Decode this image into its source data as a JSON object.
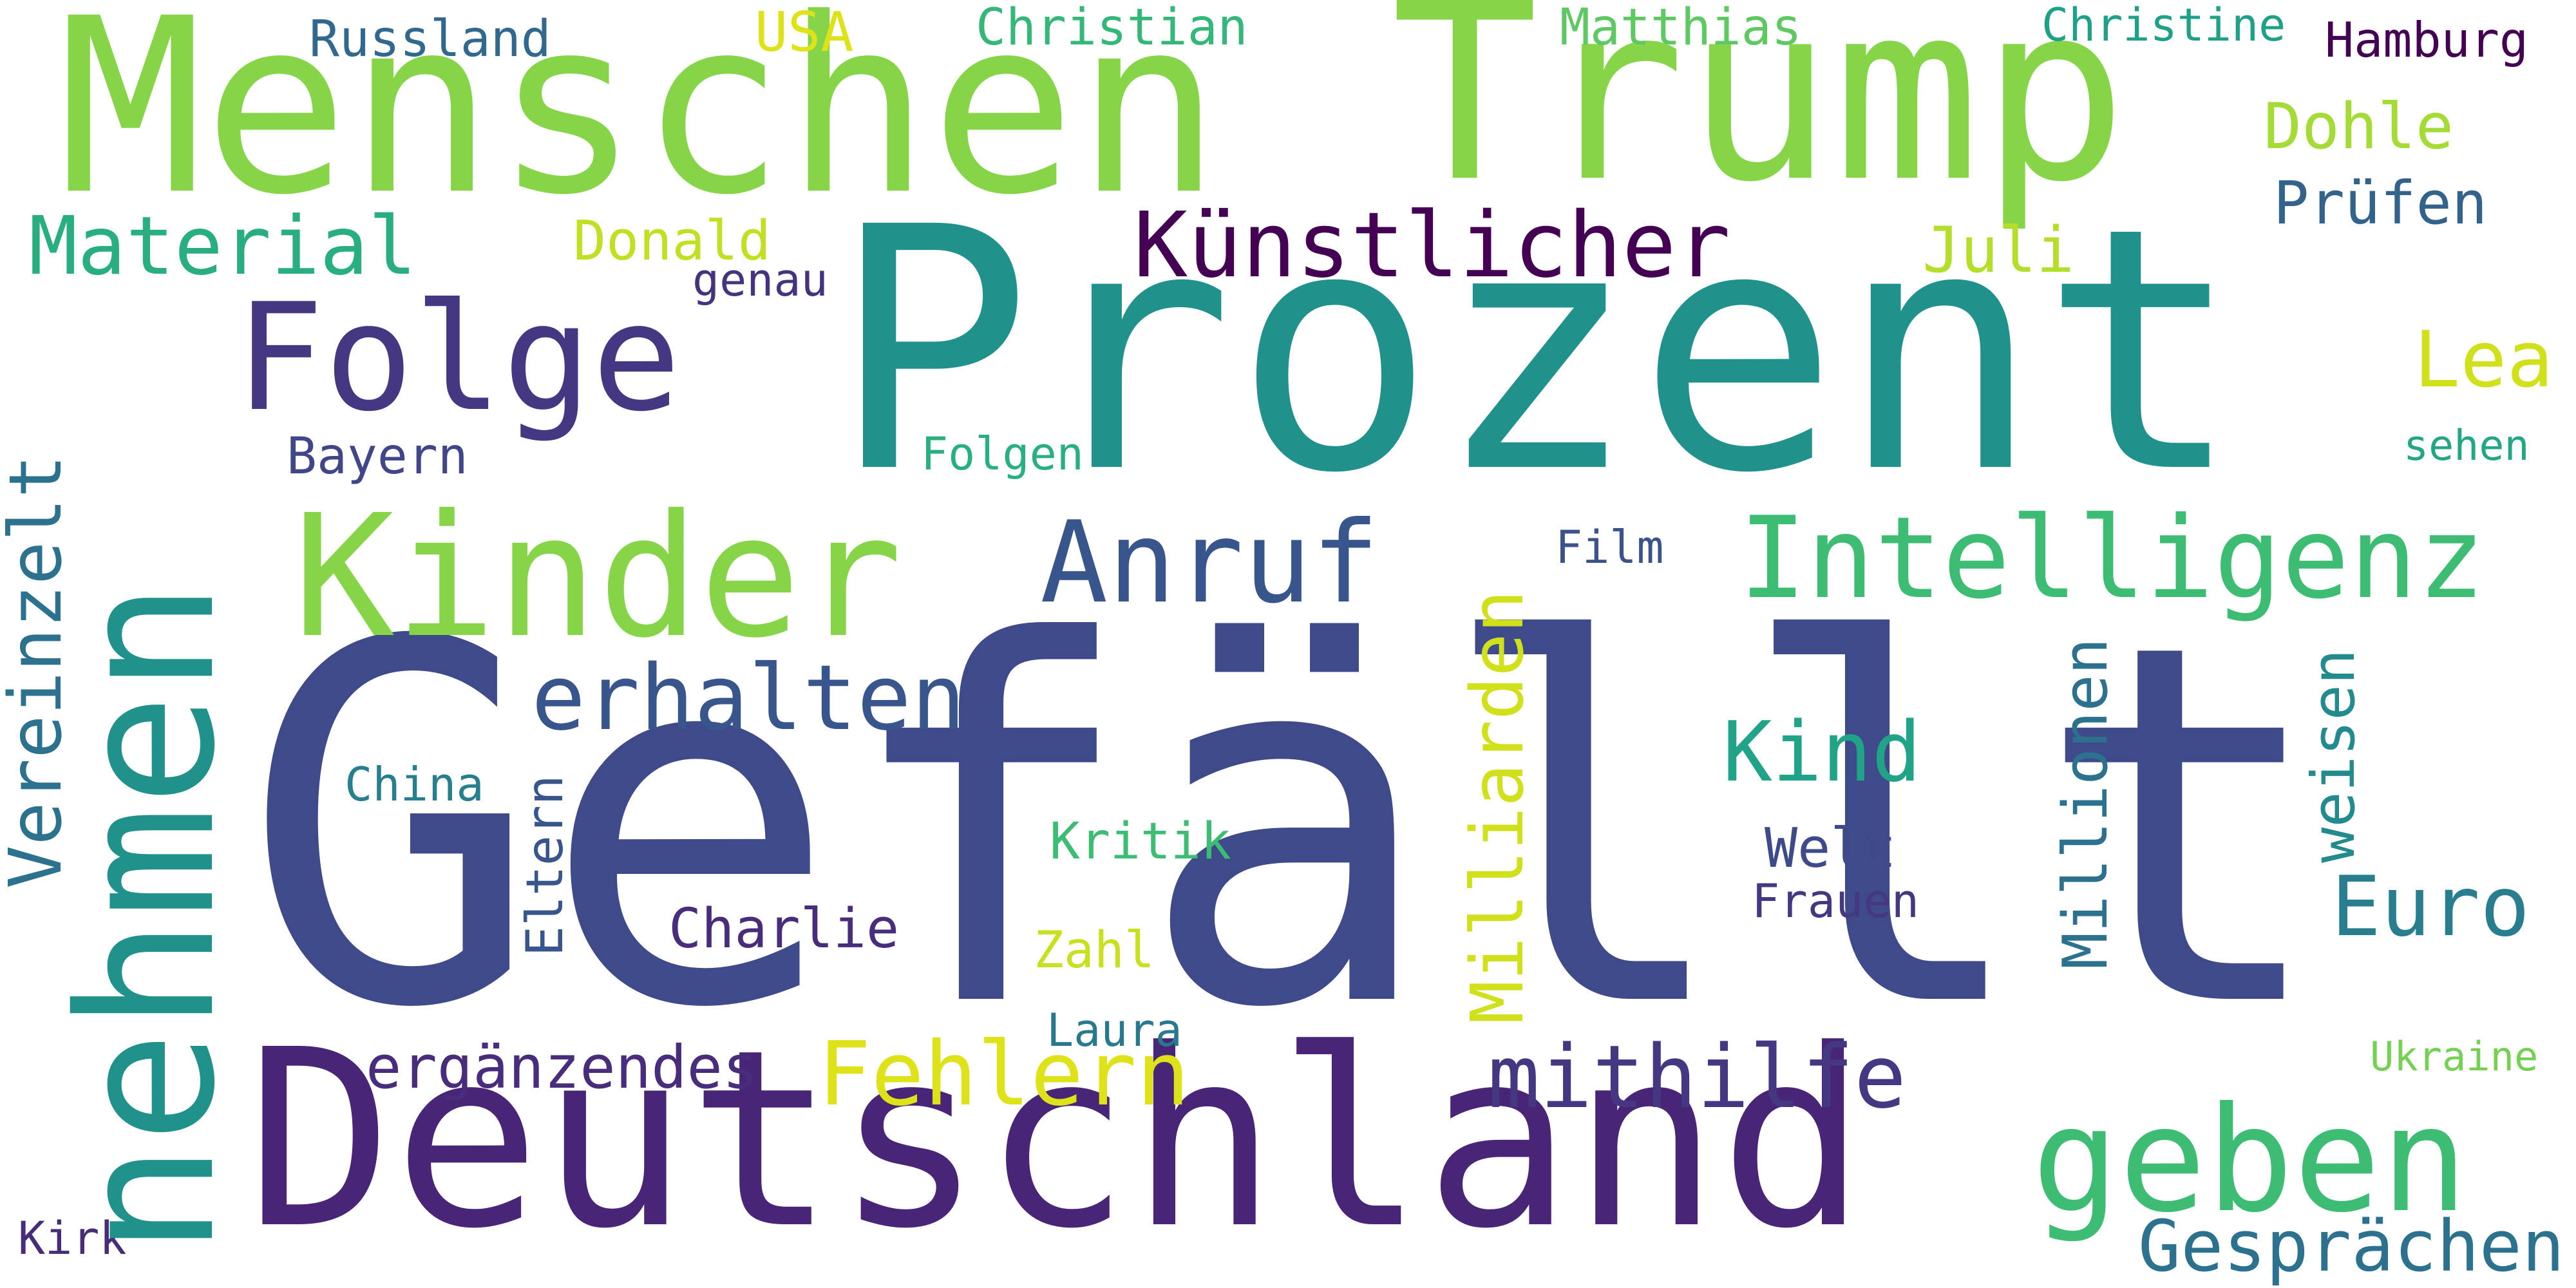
{
  "words": {
    "gefaellt": {
      "text": "Gefällt",
      "color": "#3e4a89"
    },
    "prozent": {
      "text": "Prozent",
      "color": "#21918c"
    },
    "deutschland": {
      "text": "Deutschland",
      "color": "#482576"
    },
    "menschen": {
      "text": "Menschen",
      "color": "#86d549"
    },
    "trump": {
      "text": "Trump",
      "color": "#86d549"
    },
    "nehmen": {
      "text": "nehmen",
      "color": "#21918c"
    },
    "kinder": {
      "text": "Kinder",
      "color": "#86d549"
    },
    "folge": {
      "text": "Folge",
      "color": "#453781"
    },
    "geben": {
      "text": "geben",
      "color": "#3dbc74"
    },
    "intelligenz": {
      "text": "Intelligenz",
      "color": "#3dbc74"
    },
    "kuenstlicher": {
      "text": "Künstlicher",
      "color": "#440154"
    },
    "anruf": {
      "text": "Anruf",
      "color": "#39568c"
    },
    "vereinzelt": {
      "text": "Vereinzelt",
      "color": "#2c728e"
    },
    "milliarden": {
      "text": "Milliarden",
      "color": "#d0e11c"
    },
    "erhalten": {
      "text": "erhalten",
      "color": "#39568c"
    },
    "mithilfe": {
      "text": "mithilfe",
      "color": "#453781"
    },
    "fehlern": {
      "text": "Fehlern",
      "color": "#dde318"
    },
    "material": {
      "text": "Material",
      "color": "#29af7f"
    },
    "kind": {
      "text": "Kind",
      "color": "#20a386"
    },
    "euro": {
      "text": "Euro",
      "color": "#287d8e"
    },
    "gespraechen": {
      "text": "Gesprächen",
      "color": "#2c728e"
    },
    "ergaenzendes": {
      "text": "ergänzendes",
      "color": "#472d7b"
    },
    "millionen": {
      "text": "Millionen",
      "color": "#2c728e"
    },
    "weisen": {
      "text": "weisen",
      "color": "#238a8d"
    },
    "dohle": {
      "text": "Dohle",
      "color": "#a5db36"
    },
    "lea": {
      "text": "Lea",
      "color": "#d0e11c"
    },
    "pruefen": {
      "text": "Prüfen",
      "color": "#33638d"
    },
    "juli": {
      "text": "Juli",
      "color": "#b5de2b"
    },
    "eltern": {
      "text": "Eltern",
      "color": "#39568c"
    },
    "charlie": {
      "text": "Charlie",
      "color": "#472d7b"
    },
    "welt": {
      "text": "Welt",
      "color": "#3e4a89"
    },
    "frauen": {
      "text": "Frauen",
      "color": "#453781"
    },
    "bayern": {
      "text": "Bayern",
      "color": "#404688"
    },
    "russland": {
      "text": "Russland",
      "color": "#31688e"
    },
    "usa": {
      "text": "USA",
      "color": "#dde318"
    },
    "christian": {
      "text": "Christian",
      "color": "#35b779"
    },
    "matthias": {
      "text": "Matthias",
      "color": "#5ec962"
    },
    "christine": {
      "text": "Christine",
      "color": "#1fa188"
    },
    "hamburg": {
      "text": "Hamburg",
      "color": "#440154"
    },
    "donald": {
      "text": "Donald",
      "color": "#c2df23"
    },
    "genau": {
      "text": "genau",
      "color": "#46337e"
    },
    "folgen": {
      "text": "Folgen",
      "color": "#2ab07f"
    },
    "film": {
      "text": "Film",
      "color": "#3b528b"
    },
    "sehen": {
      "text": "sehen",
      "color": "#22a785"
    },
    "china": {
      "text": "China",
      "color": "#277f8e"
    },
    "kritik": {
      "text": "Kritik",
      "color": "#3dbc74"
    },
    "zahl": {
      "text": "Zahl",
      "color": "#c8e020"
    },
    "laura": {
      "text": "Laura",
      "color": "#2a788e"
    },
    "ukraine": {
      "text": "Ukraine",
      "color": "#75d054"
    },
    "kirk": {
      "text": "Kirk",
      "color": "#472c7a"
    }
  }
}
